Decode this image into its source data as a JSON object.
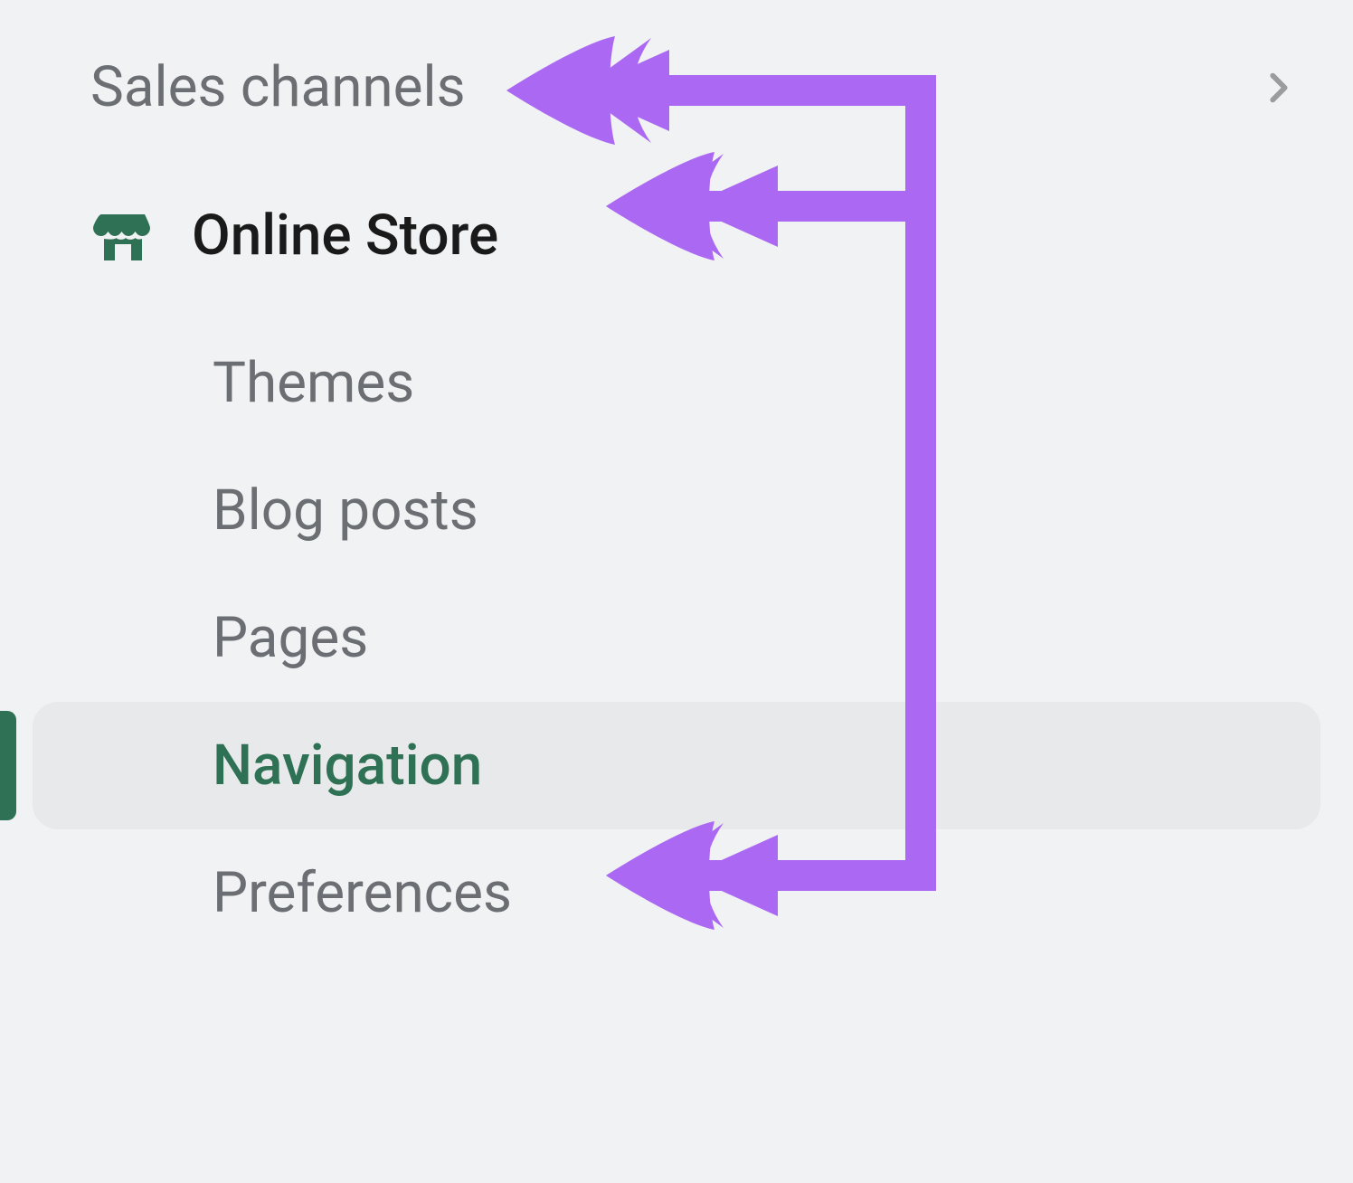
{
  "sidebar": {
    "section_header": "Sales channels",
    "primary_item": {
      "label": "Online Store"
    },
    "sub_items": [
      {
        "label": "Themes",
        "selected": false
      },
      {
        "label": "Blog posts",
        "selected": false
      },
      {
        "label": "Pages",
        "selected": false
      },
      {
        "label": "Navigation",
        "selected": true
      },
      {
        "label": "Preferences",
        "selected": false
      }
    ]
  },
  "colors": {
    "accent_green": "#2f7155",
    "text_muted": "#6b6f73",
    "annotation_purple": "#ab68f3"
  }
}
